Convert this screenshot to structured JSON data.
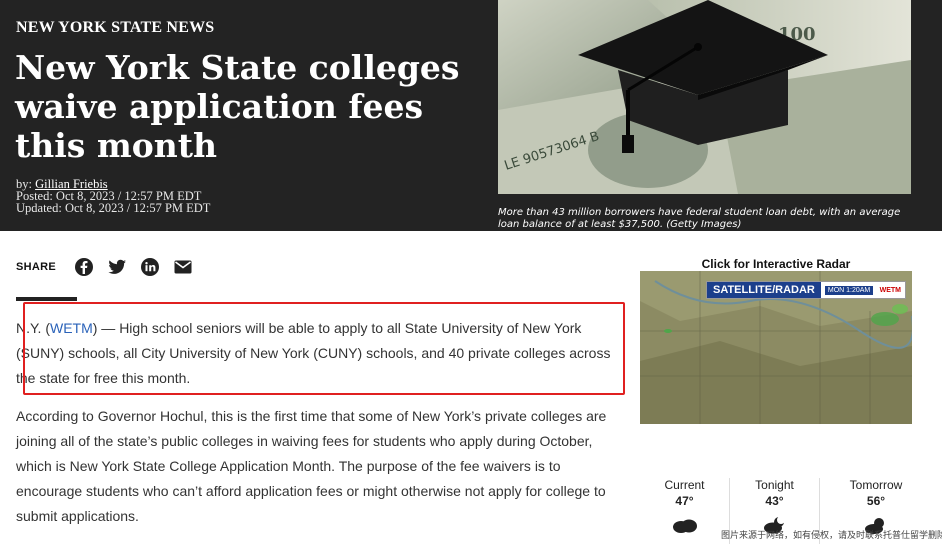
{
  "header": {
    "kicker": "NEW YORK STATE NEWS",
    "headline": "New York State colleges waive application fees this month",
    "byline_prefix": "by:",
    "author": "Gillian Friebis",
    "posted": "Posted: Oct 8, 2023 / 12:57 PM EDT",
    "updated": "Updated: Oct 8, 2023 / 12:57 PM EDT",
    "photo_caption": "More than 43 million borrowers have federal student loan debt, with an average loan balance of at least $37,500. (Getty Images)"
  },
  "share": {
    "label": "SHARE",
    "icons": [
      "facebook-icon",
      "twitter-icon",
      "linkedin-icon",
      "email-icon"
    ]
  },
  "article": {
    "p1_prefix": "N.Y. (",
    "p1_link": "WETM",
    "p1_rest": ") — High school seniors will be able to apply to all State University of New York (SUNY) schools, all City University of New York (CUNY) schools, and 40 private colleges across the state for free this month.",
    "p2": "According to Governor Hochul, this is the first time that some of New York’s private colleges are joining all of the state’s public colleges in waiving fees for students who apply during October, which is New York State College Application Month. The purpose of the fee waivers is to encourage students who can’t afford application fees or might otherwise not apply for college to submit applications."
  },
  "sidebar": {
    "radar_title": "Click for Interactive Radar",
    "radar_banner": "SATELLITE/RADAR",
    "radar_time": "MON 1:20AM",
    "radar_brand": "WETM",
    "forecast": [
      {
        "label": "Current",
        "temp": "47°",
        "icon": "cloudy-icon"
      },
      {
        "label": "Tonight",
        "temp": "43°",
        "icon": "night-cloudy-icon"
      },
      {
        "label": "Tomorrow",
        "temp": "56°",
        "icon": "partly-sunny-icon"
      }
    ]
  },
  "watermark": "图片来源于网络，如有侵权，请及时联系托普仕留学删除"
}
